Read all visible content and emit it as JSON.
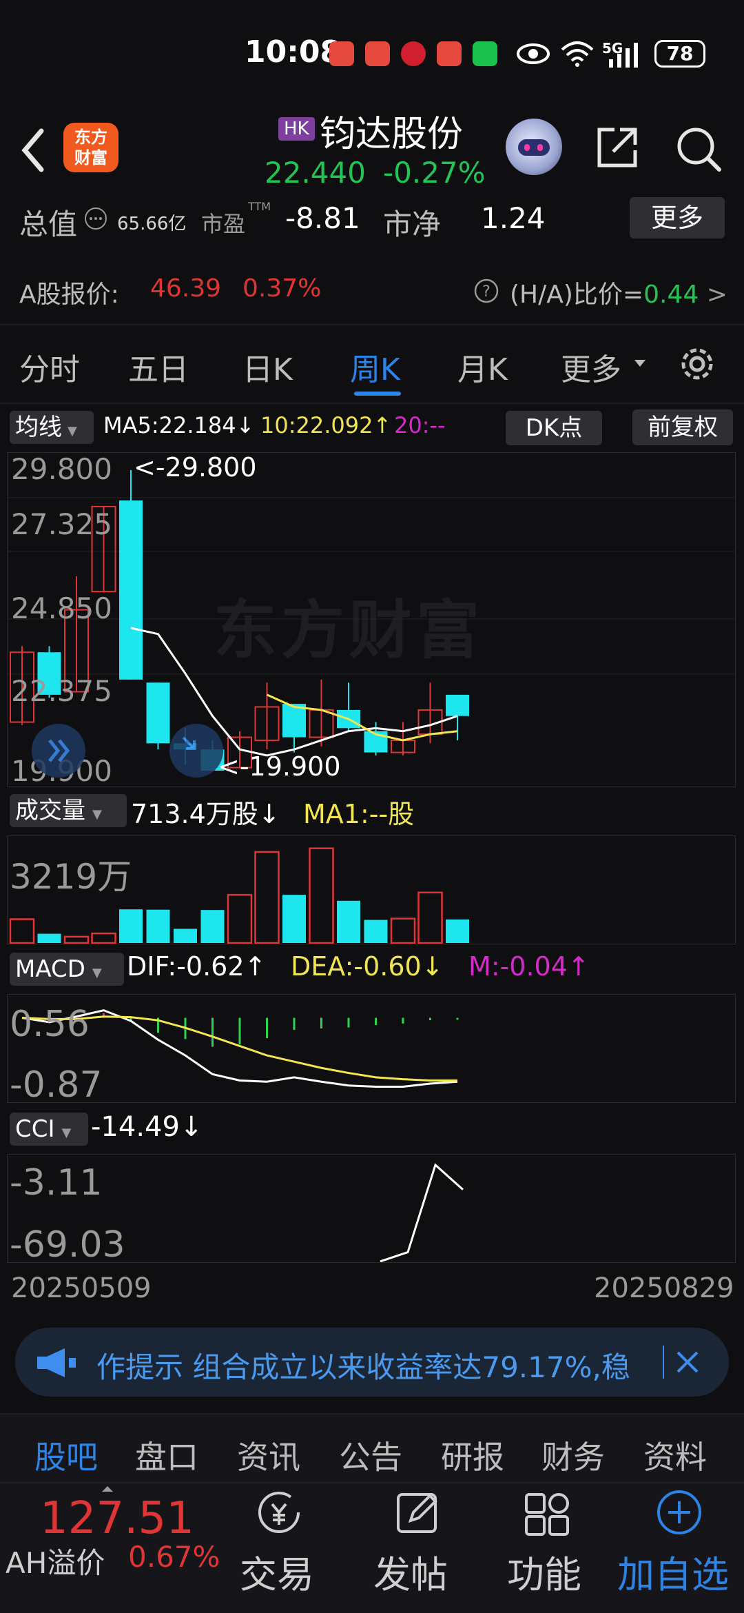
{
  "status_bar": {
    "time": "10:08",
    "battery": "78",
    "network": "5G"
  },
  "header": {
    "logo_text": "东方\n财富",
    "market_badge": "HK",
    "stock_name": "钧达股份",
    "price": "22.440",
    "change_pct": "-0.27%"
  },
  "summary": {
    "total_value_label": "总值",
    "total_value": "65.66亿",
    "pe_label": "市盈",
    "pe_sup": "TTM",
    "pe_value": "-8.81",
    "pb_label": "市净",
    "pb_value": "1.24",
    "more_label": "更多",
    "a_share_label": "A股报价:",
    "a_share_price": "46.39",
    "a_share_change": "0.37%",
    "ha_ratio_label": "(H/A)比价=",
    "ha_ratio_value": "0.44",
    "ha_arrow": ">"
  },
  "tabs": [
    "分时",
    "五日",
    "日K",
    "周K",
    "月K",
    "更多"
  ],
  "active_tab": "周K",
  "main_indicator": {
    "selector_label": "均线",
    "ma5": "MA5:22.184↓",
    "ma10": "10:22.092↑",
    "ma20": "20:--",
    "dk_label": "DK点",
    "adjust_label": "前复权"
  },
  "kline": {
    "y_labels": [
      "29.800",
      "27.325",
      "24.850",
      "22.375",
      "19.900"
    ],
    "high_annot": "<-29.800",
    "low_annot": "<-19.900",
    "watermark": "东方财富"
  },
  "volume": {
    "selector_label": "成交量",
    "value": "713.4万股↓",
    "ma1": "MA1:--股",
    "y_label": "3219万"
  },
  "macd": {
    "selector_label": "MACD",
    "dif": "DIF:-0.62↑",
    "dea": "DEA:-0.60↓",
    "m": "M:-0.04↑",
    "y_labels": [
      "0.56",
      "-0.87"
    ]
  },
  "cci": {
    "selector_label": "CCI",
    "value": "-14.49↓",
    "y_labels": [
      "-3.11",
      "-69.03"
    ]
  },
  "date_range": {
    "start": "20250509",
    "end": "20250829"
  },
  "banner": {
    "text": "作提示 组合成立以来收益率达79.17%,稳"
  },
  "bottom_tabs": [
    "股吧",
    "盘口",
    "资讯",
    "公告",
    "研报",
    "财务",
    "资料"
  ],
  "active_bottom_tab": "股吧",
  "action_bar": {
    "ah_value": "127.51",
    "ah_label": "AH溢价",
    "ah_pct": "0.67%",
    "trade": "交易",
    "post": "发帖",
    "function": "功能",
    "add_watch": "加自选"
  },
  "colors": {
    "up": "#e03535",
    "down": "#1ee6ef",
    "ma5": "#ffffff",
    "ma10": "#f2e552",
    "ma20": "#d629c9",
    "accent": "#2d84e6",
    "green_text": "#24c454"
  },
  "chart_data": [
    {
      "type": "candlestick",
      "title": "周K",
      "ylim": [
        19.9,
        29.8
      ],
      "candles": [
        {
          "open": 21.5,
          "close": 23.8,
          "high": 24.0,
          "low": 21.4
        },
        {
          "open": 23.8,
          "close": 22.4,
          "high": 24.0,
          "low": 22.3
        },
        {
          "open": 22.5,
          "close": 25.2,
          "high": 26.3,
          "low": 22.5
        },
        {
          "open": 25.8,
          "close": 28.6,
          "high": 28.6,
          "low": 25.8
        },
        {
          "open": 28.8,
          "close": 22.9,
          "high": 29.8,
          "low": 22.9
        },
        {
          "open": 22.8,
          "close": 20.8,
          "high": 22.8,
          "low": 20.6
        },
        {
          "open": 20.8,
          "close": 20.6,
          "high": 21.3,
          "low": 20.1
        },
        {
          "open": 20.6,
          "close": 19.9,
          "high": 20.9,
          "low": 19.9
        },
        {
          "open": 20.0,
          "close": 21.0,
          "high": 21.2,
          "low": 20.0
        },
        {
          "open": 20.9,
          "close": 22.0,
          "high": 22.8,
          "low": 20.6
        },
        {
          "open": 22.1,
          "close": 21.0,
          "high": 22.1,
          "low": 20.5
        },
        {
          "open": 21.0,
          "close": 21.9,
          "high": 22.9,
          "low": 20.7
        },
        {
          "open": 21.9,
          "close": 21.3,
          "high": 22.8,
          "low": 21.2
        },
        {
          "open": 21.2,
          "close": 20.5,
          "high": 21.5,
          "low": 20.4
        },
        {
          "open": 20.5,
          "close": 20.9,
          "high": 21.5,
          "low": 20.4
        },
        {
          "open": 21.1,
          "close": 21.9,
          "high": 22.8,
          "low": 20.8
        },
        {
          "open": 22.4,
          "close": 21.7,
          "high": 22.4,
          "low": 20.9
        }
      ],
      "ma5": [
        null,
        null,
        null,
        null,
        24.6,
        24.4,
        23.1,
        21.7,
        20.6,
        20.4,
        20.6,
        20.9,
        21.2,
        21.3,
        21.2,
        21.4,
        21.7
      ],
      "ma10": [
        null,
        null,
        null,
        null,
        null,
        null,
        null,
        null,
        null,
        22.4,
        22.0,
        21.9,
        21.6,
        21.1,
        20.9,
        21.1,
        21.2
      ]
    },
    {
      "type": "bar",
      "title": "成交量",
      "y_max": 3219,
      "unit": "万",
      "values": [
        720,
        280,
        190,
        290,
        1020,
        1010,
        430,
        1000,
        1460,
        2760,
        1460,
        2870,
        1280,
        700,
        740,
        1530,
        713
      ],
      "directions": [
        "up",
        "down",
        "up",
        "up",
        "down",
        "down",
        "down",
        "down",
        "up",
        "up",
        "down",
        "up",
        "down",
        "down",
        "up",
        "up",
        "down"
      ]
    },
    {
      "type": "line",
      "title": "MACD",
      "ylim": [
        -0.87,
        0.56
      ],
      "dif": [
        0.4,
        0.33,
        0.42,
        0.52,
        0.35,
        0.05,
        -0.2,
        -0.5,
        -0.6,
        -0.62,
        -0.55,
        -0.62,
        -0.68,
        -0.7,
        -0.7,
        -0.65,
        -0.62
      ],
      "dea": [
        0.4,
        0.38,
        0.38,
        0.42,
        0.41,
        0.36,
        0.24,
        0.1,
        -0.05,
        -0.2,
        -0.3,
        -0.4,
        -0.48,
        -0.55,
        -0.58,
        -0.6,
        -0.6
      ],
      "m": [
        0.0,
        -0.05,
        0.04,
        0.1,
        -0.06,
        -0.31,
        -0.44,
        -0.6,
        -0.55,
        -0.42,
        -0.25,
        -0.22,
        -0.2,
        -0.15,
        -0.12,
        -0.05,
        -0.04
      ]
    },
    {
      "type": "line",
      "title": "CCI",
      "ylim": [
        -69.03,
        -3.11
      ],
      "values": [
        null,
        null,
        null,
        null,
        null,
        null,
        null,
        null,
        null,
        null,
        null,
        null,
        null,
        null,
        -69.0,
        -62.0,
        10.0,
        -14.49
      ]
    }
  ]
}
